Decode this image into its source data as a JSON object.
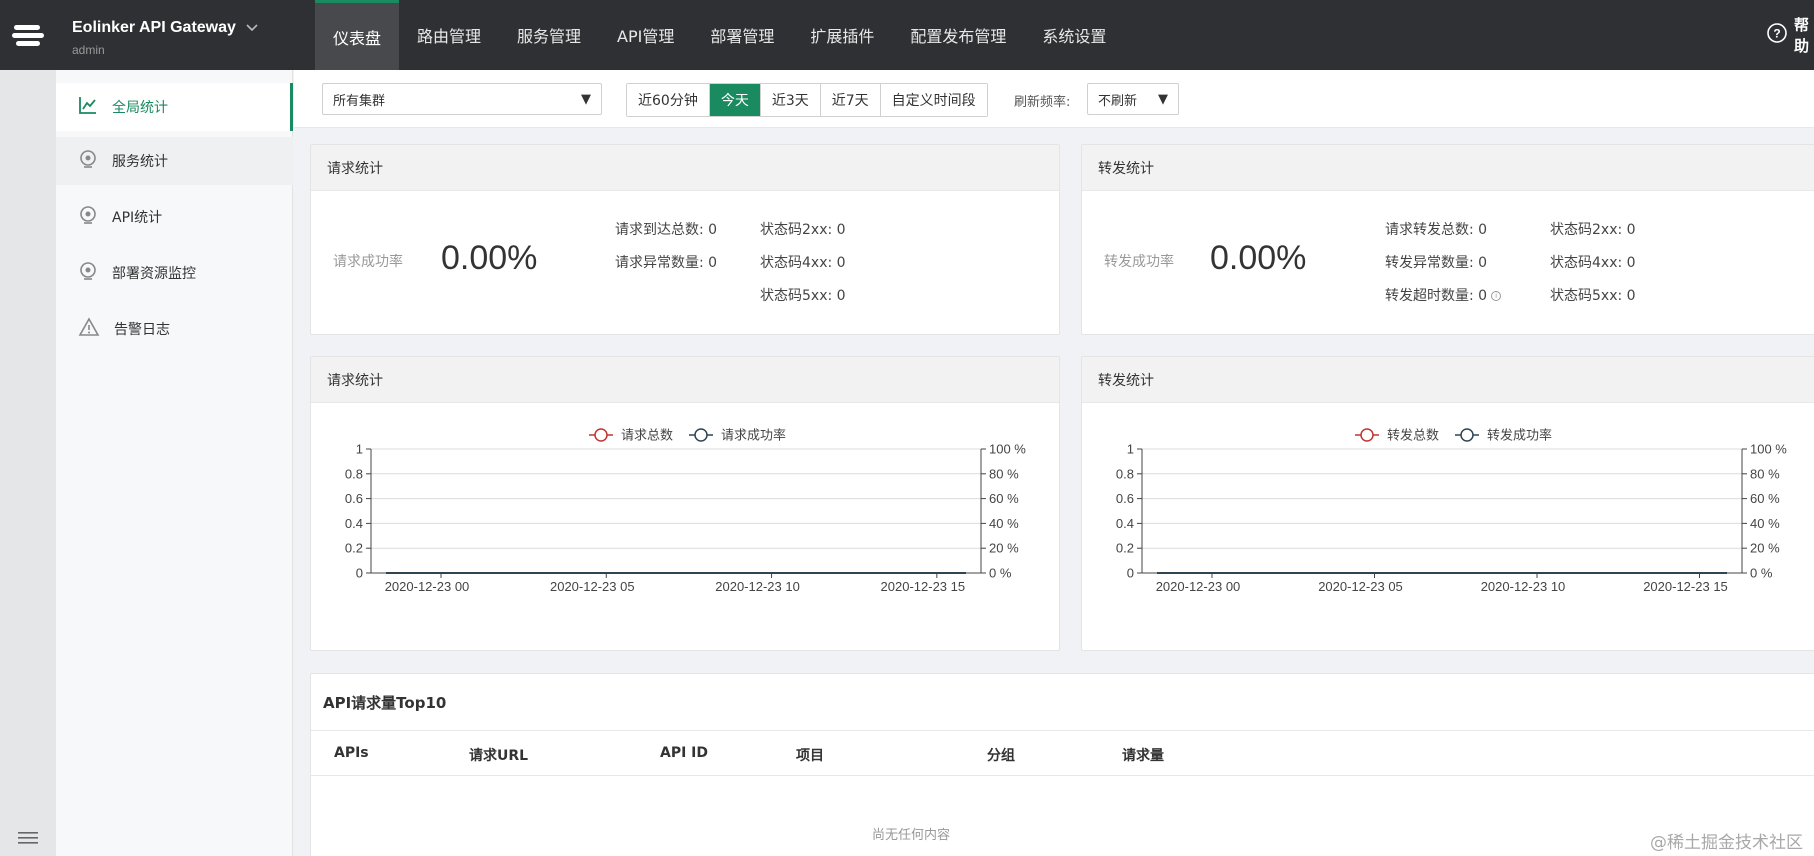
{
  "header": {
    "brand_title": "Eolinker API Gateway",
    "brand_user": "admin",
    "nav": [
      "仪表盘",
      "路由管理",
      "服务管理",
      "API管理",
      "部署管理",
      "扩展插件",
      "配置发布管理",
      "系统设置"
    ],
    "active_nav": 0,
    "help_label": "帮助"
  },
  "sidebar": {
    "items": [
      {
        "label": "全局统计",
        "icon": "line-chart-icon"
      },
      {
        "label": "服务统计",
        "icon": "location-icon"
      },
      {
        "label": "API统计",
        "icon": "location-icon"
      },
      {
        "label": "部署资源监控",
        "icon": "location-icon"
      },
      {
        "label": "告警日志",
        "icon": "warning-icon"
      }
    ]
  },
  "filters": {
    "cluster_value": "所有集群",
    "time_options": [
      "近60分钟",
      "今天",
      "近3天",
      "近7天",
      "自定义时间段"
    ],
    "time_active": 1,
    "refresh_label": "刷新频率:",
    "refresh_value": "不刷新"
  },
  "request_stats": {
    "title": "请求统计",
    "rate_label": "请求成功率",
    "rate_value": "0.00%",
    "total_label": "请求到达总数:",
    "total_value": "0",
    "error_label": "请求异常数量:",
    "error_value": "0",
    "s2xx_label": "状态码2xx:",
    "s2xx_value": "0",
    "s4xx_label": "状态码4xx:",
    "s4xx_value": "0",
    "s5xx_label": "状态码5xx:",
    "s5xx_value": "0"
  },
  "forward_stats": {
    "title": "转发统计",
    "rate_label": "转发成功率",
    "rate_value": "0.00%",
    "total_label": "请求转发总数:",
    "total_value": "0",
    "error_label": "转发异常数量:",
    "error_value": "0",
    "timeout_label": "转发超时数量:",
    "timeout_value": "0",
    "s2xx_label": "状态码2xx:",
    "s2xx_value": "0",
    "s4xx_label": "状态码4xx:",
    "s4xx_value": "0",
    "s5xx_label": "状态码5xx:",
    "s5xx_value": "0"
  },
  "chart_data": [
    {
      "type": "line",
      "title": "请求统计",
      "x": [
        "2020-12-23 00",
        "2020-12-23 05",
        "2020-12-23 10",
        "2020-12-23 15"
      ],
      "series": [
        {
          "name": "请求总数",
          "values": [
            0,
            0,
            0,
            0
          ],
          "color": "#c23531",
          "axis": "left"
        },
        {
          "name": "请求成功率",
          "values": [
            0,
            0,
            0,
            0
          ],
          "color": "#2f4554",
          "axis": "right"
        }
      ],
      "ylim": [
        0,
        1
      ],
      "y_ticks": [
        "0",
        "0.2",
        "0.4",
        "0.6",
        "0.8",
        "1"
      ],
      "y2lim": [
        0,
        100
      ],
      "y2_ticks": [
        "0 %",
        "20 %",
        "40 %",
        "60 %",
        "80 %",
        "100 %"
      ],
      "legend": "top-center",
      "grid": true
    },
    {
      "type": "line",
      "title": "转发统计",
      "x": [
        "2020-12-23 00",
        "2020-12-23 05",
        "2020-12-23 10",
        "2020-12-23 15"
      ],
      "series": [
        {
          "name": "转发总数",
          "values": [
            0,
            0,
            0,
            0
          ],
          "color": "#c23531",
          "axis": "left"
        },
        {
          "name": "转发成功率",
          "values": [
            0,
            0,
            0,
            0
          ],
          "color": "#2f4554",
          "axis": "right"
        }
      ],
      "ylim": [
        0,
        1
      ],
      "y_ticks": [
        "0",
        "0.2",
        "0.4",
        "0.6",
        "0.8",
        "1"
      ],
      "y2lim": [
        0,
        100
      ],
      "y2_ticks": [
        "0 %",
        "20 %",
        "40 %",
        "60 %",
        "80 %",
        "100 %"
      ],
      "legend": "top-center",
      "grid": true
    }
  ],
  "top10": {
    "title": "API请求量Top10",
    "columns": [
      "APIs",
      "请求URL",
      "API ID",
      "项目",
      "分组",
      "请求量"
    ],
    "empty_text": "尚无任何内容"
  },
  "watermark": "@稀土掘金技术社区",
  "colors": {
    "accent": "#1a8a61",
    "topbar": "#2f3033"
  }
}
